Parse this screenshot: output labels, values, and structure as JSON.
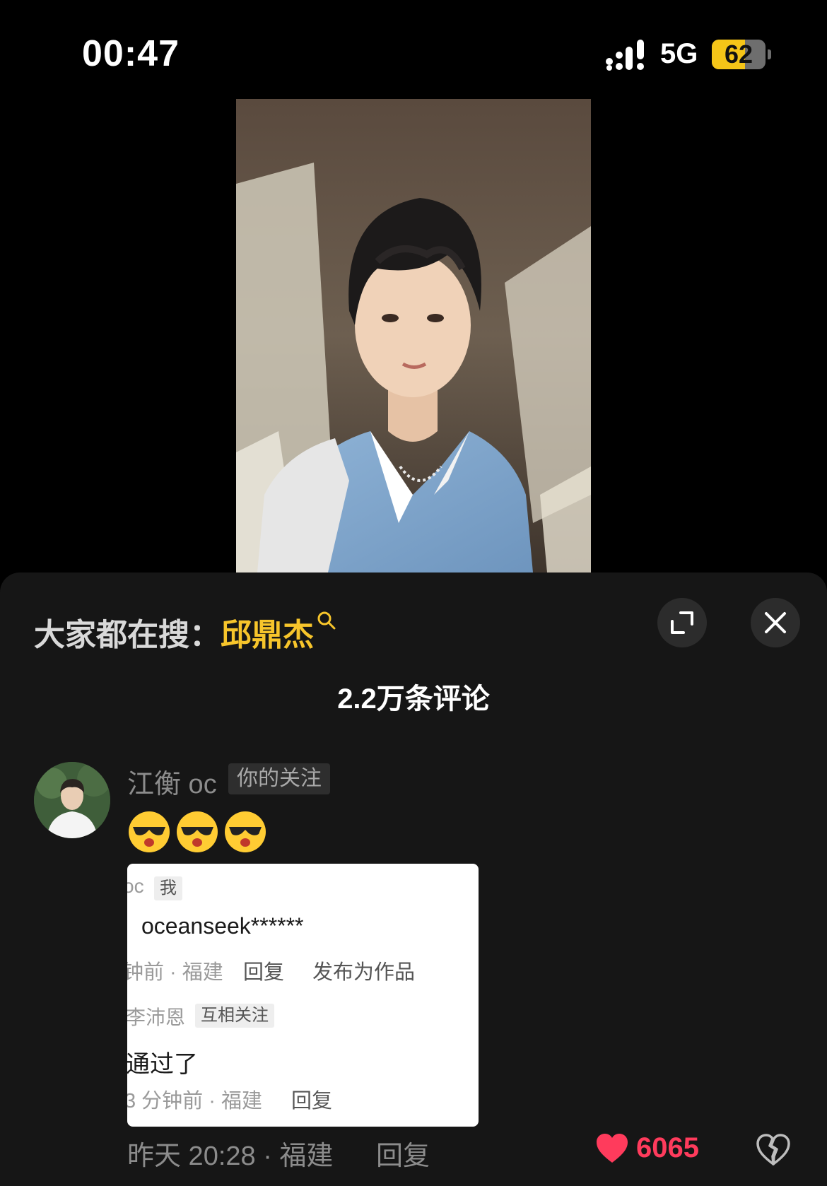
{
  "status_bar": {
    "time": "00:47",
    "network": "5G",
    "battery": "62",
    "battery_level": 0.62
  },
  "video": {
    "image": "portrait-photo"
  },
  "comment_sheet": {
    "search_prefix": "大家都在搜：",
    "search_keyword": "邱鼎杰",
    "comment_count": "2.2万条评论",
    "accent_color": "#f7c52b",
    "comment": {
      "username": "江衡 oc",
      "badge": "你的关注",
      "emoji": [
        "cool-emoji",
        "cool-emoji",
        "cool-emoji"
      ],
      "attached_screenshot": {
        "user1": "oc",
        "user1_badge": "我",
        "text1": "oceanseek******",
        "meta1": "钟前 · 福建",
        "reply1": "回复",
        "publish": "发布为作品",
        "user2": "李沛恩",
        "user2_badge": "互相关注",
        "text2": "通过了",
        "meta2": "3 分钟前 · 福建",
        "reply2": "回复"
      },
      "time_location": "昨天 20:28 · 福建",
      "reply_label": "回复",
      "likes": "6065",
      "like_color": "#ff3b5c"
    }
  }
}
